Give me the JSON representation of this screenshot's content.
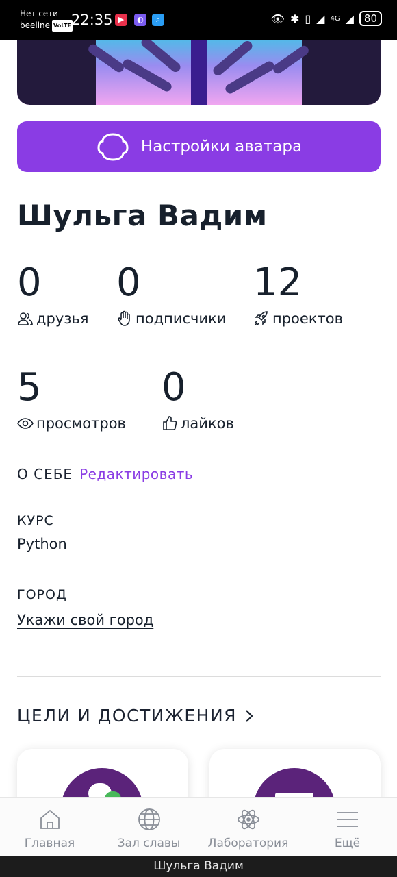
{
  "status_bar": {
    "network": "Нет сети",
    "carrier": "beeline",
    "volte": "VoLTE",
    "time": "22:35",
    "signal": "4G",
    "battery": "80"
  },
  "avatar_settings_label": "Настройки аватара",
  "profile": {
    "name": "Шульга Вадим"
  },
  "stats": {
    "friends": {
      "value": "0",
      "label": "друзья"
    },
    "followers": {
      "value": "0",
      "label": "подписчики"
    },
    "projects": {
      "value": "12",
      "label": "проектов"
    },
    "views": {
      "value": "5",
      "label": "просмотров"
    },
    "likes": {
      "value": "0",
      "label": "лайков"
    }
  },
  "about": {
    "label": "О СЕБЕ",
    "edit_label": "Редактировать"
  },
  "course": {
    "label": "КУРС",
    "value": "Python"
  },
  "city": {
    "label": "ГОРОД",
    "link": "Укажи свой город"
  },
  "goals": {
    "label": "ЦЕЛИ И ДОСТИЖЕНИЯ"
  },
  "bottom_nav": [
    {
      "label": "Главная",
      "icon": "home-icon"
    },
    {
      "label": "Зал славы",
      "icon": "globe-icon"
    },
    {
      "label": "Лаборатория",
      "icon": "atom-icon"
    },
    {
      "label": "Ещё",
      "icon": "menu-icon"
    }
  ],
  "footer_title": "Шульга Вадим",
  "colors": {
    "accent": "#8a3ce4",
    "text": "#17202c",
    "nav_text": "#8a8f98"
  }
}
